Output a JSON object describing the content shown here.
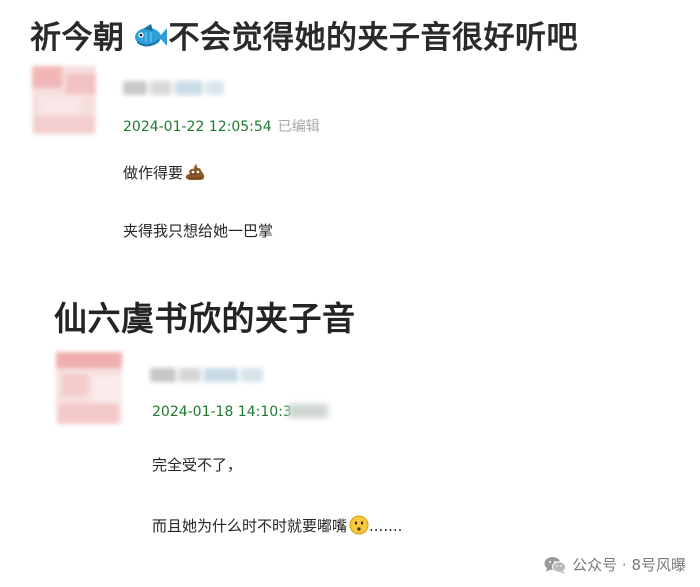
{
  "post1": {
    "title_prefix": "祈今朝",
    "title_suffix": "不会觉得她的夹子音很好听吧",
    "timestamp": "2024-01-22 12:05:54",
    "edited_label": "已编辑",
    "comments": [
      "做作得要",
      "夹得我只想给她一巴掌"
    ]
  },
  "post2": {
    "title": "仙六虞书欣的夹子音",
    "timestamp": "2024-01-18 14:10:3",
    "comments": [
      "完全受不了，",
      "而且她为什么时不时就要嘟嘴",
      "......."
    ]
  },
  "watermark": {
    "text": "公众号 · 8号风曝"
  },
  "icons": {
    "title_fish": "fish-emoji-icon",
    "comment_poop": "poop-emoji-icon",
    "comment_face": "hushed-face-emoji-icon",
    "watermark": "wechat-icon"
  },
  "colors": {
    "timestamp": "#1f7a2e",
    "edited": "#a8a8a8",
    "avatar_pink": "#f2b3b3",
    "watermark": "#7a7a7a"
  }
}
